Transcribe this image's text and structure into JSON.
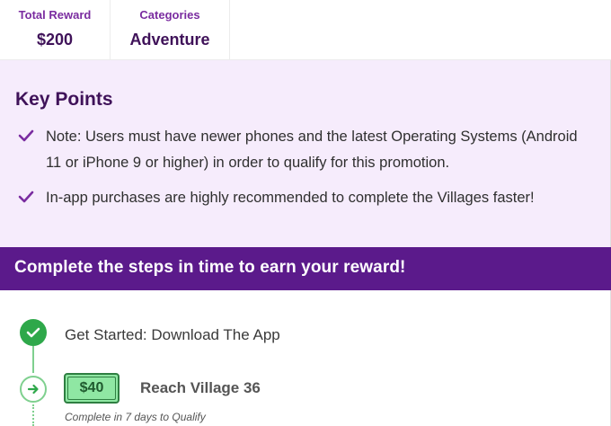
{
  "stats": {
    "reward_label": "Total Reward",
    "reward_value": "$200",
    "categories_label": "Categories",
    "categories_value": "Adventure"
  },
  "key_points": {
    "title": "Key Points",
    "items": [
      "Note: Users must have newer phones and the latest Operating Systems (Android 11 or iPhone 9 or higher) in order to qualify for this promotion.",
      "In-app purchases are highly recommended to complete the Villages faster!"
    ],
    "icon": "check-icon"
  },
  "banner": {
    "text": "Complete the steps in time to earn your reward!"
  },
  "steps": {
    "items": [
      {
        "label": "Get Started: Download The App",
        "status": "completed",
        "icon": "check-circle-icon"
      },
      {
        "reward": "$40",
        "label": "Reach Village 36",
        "sublabel": "Complete in 7 days to Qualify",
        "status": "current",
        "icon": "arrow-right-circle-icon"
      }
    ]
  },
  "colors": {
    "purple_dark": "#3f1259",
    "purple_banner": "#5b1a8b",
    "panel_bg": "#f6ecfc",
    "green": "#2ea84a",
    "green_light": "#8fe7a3"
  }
}
